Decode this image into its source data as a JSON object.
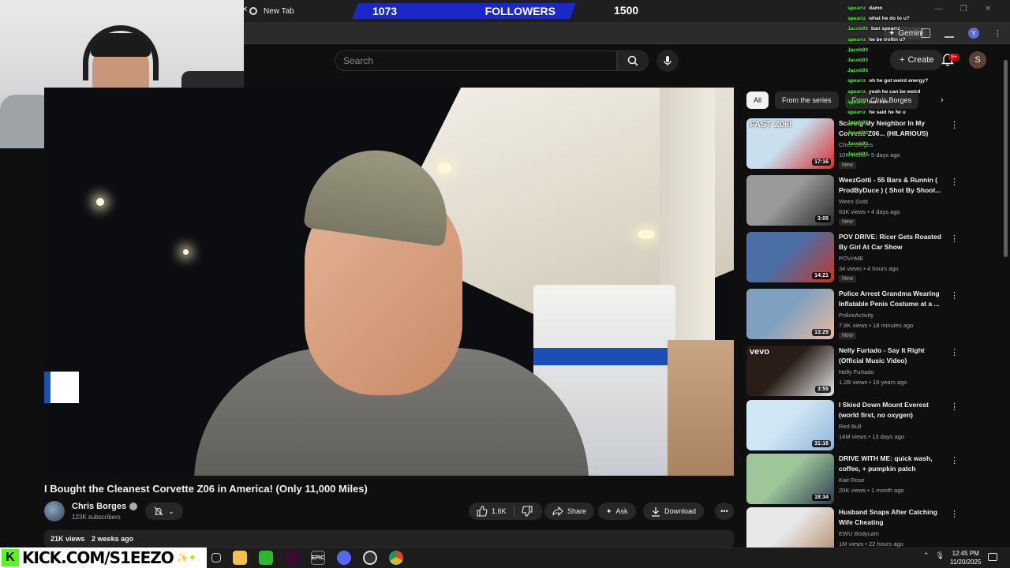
{
  "browser": {
    "tab_title": "New Tab",
    "gemini_label": "Gemini",
    "profile_initial": "Y"
  },
  "followers": {
    "current": "1073",
    "label": "FOLLOWERS",
    "goal": "1500"
  },
  "youtube": {
    "search_placeholder": "Search",
    "create_label": "Create",
    "notification_count": "9+",
    "avatar_initial": "S"
  },
  "video": {
    "title": "I Bought the Cleanest Corvette Z06 in America! (Only 11,000 Miles)",
    "channel": "Chris Borges",
    "subscribers": "123K subscribers",
    "likes": "1.6K",
    "share_label": "Share",
    "ask_label": "Ask",
    "download_label": "Download",
    "views": "21K views",
    "age": "2 weeks ago"
  },
  "chips": [
    "All",
    "From the series",
    "From Chris Borges"
  ],
  "recommendations": [
    {
      "title": "Scaring My Neighbor In My Corvette Z06... (HILARIOUS)",
      "channel": "Chris Borges",
      "meta": "10K views • 5 days ago",
      "badge": "New",
      "duration": "17:16",
      "thumb_text": "FAST Z06!",
      "colors": [
        "#c8dff0",
        "#d32f2f"
      ]
    },
    {
      "title": "WeezGotti - 55 Bars & Runnin ( ProdByDuce ) ( Shot By Shoot...",
      "channel": "Weez Gotti",
      "meta": "53K views • 4 days ago",
      "badge": "New",
      "duration": "3:05",
      "thumb_text": "",
      "colors": [
        "#9a9a9a",
        "#2b2b2b"
      ]
    },
    {
      "title": "POV DRIVE: Ricer Gets Roasted By Girl At Car Show",
      "channel": "POVnME",
      "meta": "34 views • 4 hours ago",
      "badge": "New",
      "duration": "14:21",
      "thumb_text": "",
      "colors": [
        "#4a6fa5",
        "#c0392b"
      ]
    },
    {
      "title": "Police Arrest Grandma Wearing Inflatable Penis Costume at a ...",
      "channel": "PoliceActivity",
      "meta": "7.8K views • 18 minutes ago",
      "badge": "New",
      "duration": "13:29",
      "thumb_text": "",
      "colors": [
        "#7fa0c0",
        "#e7b9a0"
      ]
    },
    {
      "title": "Nelly Furtado - Say It Right (Official Music Video)",
      "channel": "Nelly Furtado",
      "meta": "1.2B views • 16 years ago",
      "badge": "",
      "duration": "3:55",
      "thumb_text": "vevo",
      "colors": [
        "#2a1d17",
        "#e8e8e8"
      ]
    },
    {
      "title": "I Skied Down Mount Everest (world first, no oxygen)",
      "channel": "Red Bull",
      "meta": "14M views • 13 days ago",
      "badge": "",
      "duration": "31:16",
      "thumb_text": "",
      "colors": [
        "#cfe6f5",
        "#8fb6d8"
      ]
    },
    {
      "title": "DRIVE WITH ME: quick wash, coffee, + pumpkin patch",
      "channel": "Kait Rose",
      "meta": "20K views • 1 month ago",
      "badge": "",
      "duration": "18:34",
      "thumb_text": "",
      "colors": [
        "#9fc59a",
        "#2c3e50"
      ]
    },
    {
      "title": "Husband Snaps After Catching Wife Cheating",
      "channel": "EWU Bodycam",
      "meta": "1M views • 22 hours ago",
      "badge": "",
      "duration": "",
      "thumb_text": "",
      "colors": [
        "#e8e8e8",
        "#b48a6e"
      ]
    }
  ],
  "chat": [
    {
      "user": "spearrz",
      "msg": "damn"
    },
    {
      "user": "spearrz",
      "msg": "what he do to u?"
    },
    {
      "user": "Jacob93",
      "msg": "ban spearrz"
    },
    {
      "user": "spearrz",
      "msg": "he be trollin u?"
    },
    {
      "user": "Jacob93",
      "msg": ""
    },
    {
      "user": "Jacob93",
      "msg": ""
    },
    {
      "user": "Jacob93",
      "msg": ""
    },
    {
      "user": "spearrz",
      "msg": "oh he got weird energy?"
    },
    {
      "user": "spearrz",
      "msg": "yeah he can be weird"
    },
    {
      "user": "spearrz",
      "msg": "ban him"
    },
    {
      "user": "spearrz",
      "msg": "he said he fw u"
    },
    {
      "user": "Jacob93",
      "msg": ""
    },
    {
      "user": "Jacob93",
      "msg": ""
    },
    {
      "user": "Jacob93",
      "msg": ""
    },
    {
      "user": "Jacob93",
      "msg": ""
    }
  ],
  "taskbar": {
    "kick_text": "KICK.COM/S1EEZO",
    "time": "12:45 PM",
    "date": "11/20/2025"
  },
  "colors": {
    "kick_green": "#53fc18",
    "followers_blue": "#1b28c8",
    "yt_bg": "#0f0f0f"
  }
}
